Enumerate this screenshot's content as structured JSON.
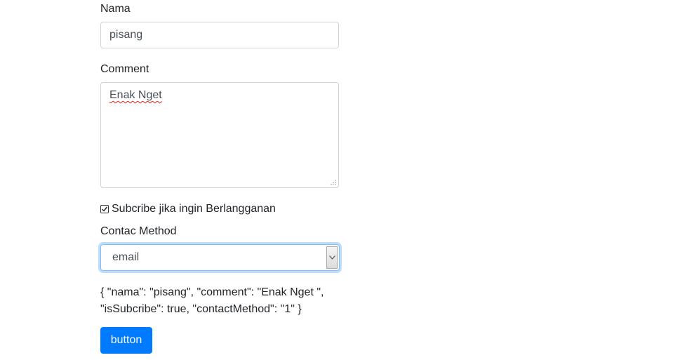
{
  "form": {
    "name_label": "Nama",
    "name_value": "pisang",
    "comment_label": "Comment",
    "comment_value": "Enak Nget",
    "subscribe_checked": true,
    "subscribe_label": "Subcribe jika ingin Berlangganan",
    "contact_label": "Contac Method",
    "contact_selected": "email",
    "json_output": "{ \"nama\": \"pisang\", \"comment\": \"Enak Nget \", \"isSubcribe\": true, \"contactMethod\": \"1\" }",
    "submit_label": "button"
  },
  "colors": {
    "primary": "#007bff",
    "border": "#ced4da",
    "focus_border": "#80bdff",
    "text": "#212529"
  }
}
